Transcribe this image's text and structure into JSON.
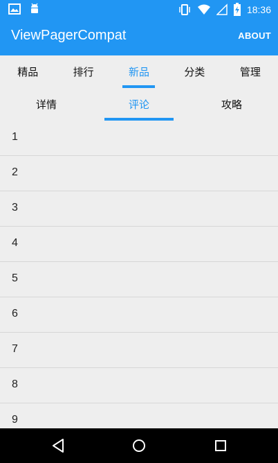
{
  "status_bar": {
    "time": "18:36",
    "icons": [
      "image-notification-icon",
      "android-icon",
      "vibrate-icon",
      "wifi-icon",
      "signal-icon",
      "battery-charging-icon"
    ]
  },
  "app_bar": {
    "title": "ViewPagerCompat",
    "action_label": "ABOUT"
  },
  "top_tabs": [
    {
      "label": "精品",
      "active": false
    },
    {
      "label": "排行",
      "active": false
    },
    {
      "label": "新品",
      "active": true
    },
    {
      "label": "分类",
      "active": false
    },
    {
      "label": "管理",
      "active": false
    }
  ],
  "sub_tabs": [
    {
      "label": "详情",
      "active": false
    },
    {
      "label": "评论",
      "active": true
    },
    {
      "label": "攻略",
      "active": false
    }
  ],
  "list_items": [
    "1",
    "2",
    "3",
    "4",
    "5",
    "6",
    "7",
    "8",
    "9"
  ],
  "nav_bar": {
    "buttons": [
      "back-icon",
      "home-icon",
      "recents-icon"
    ]
  },
  "colors": {
    "primary": "#2196f3",
    "background": "#eeeeee",
    "nav_bar": "#000000"
  }
}
